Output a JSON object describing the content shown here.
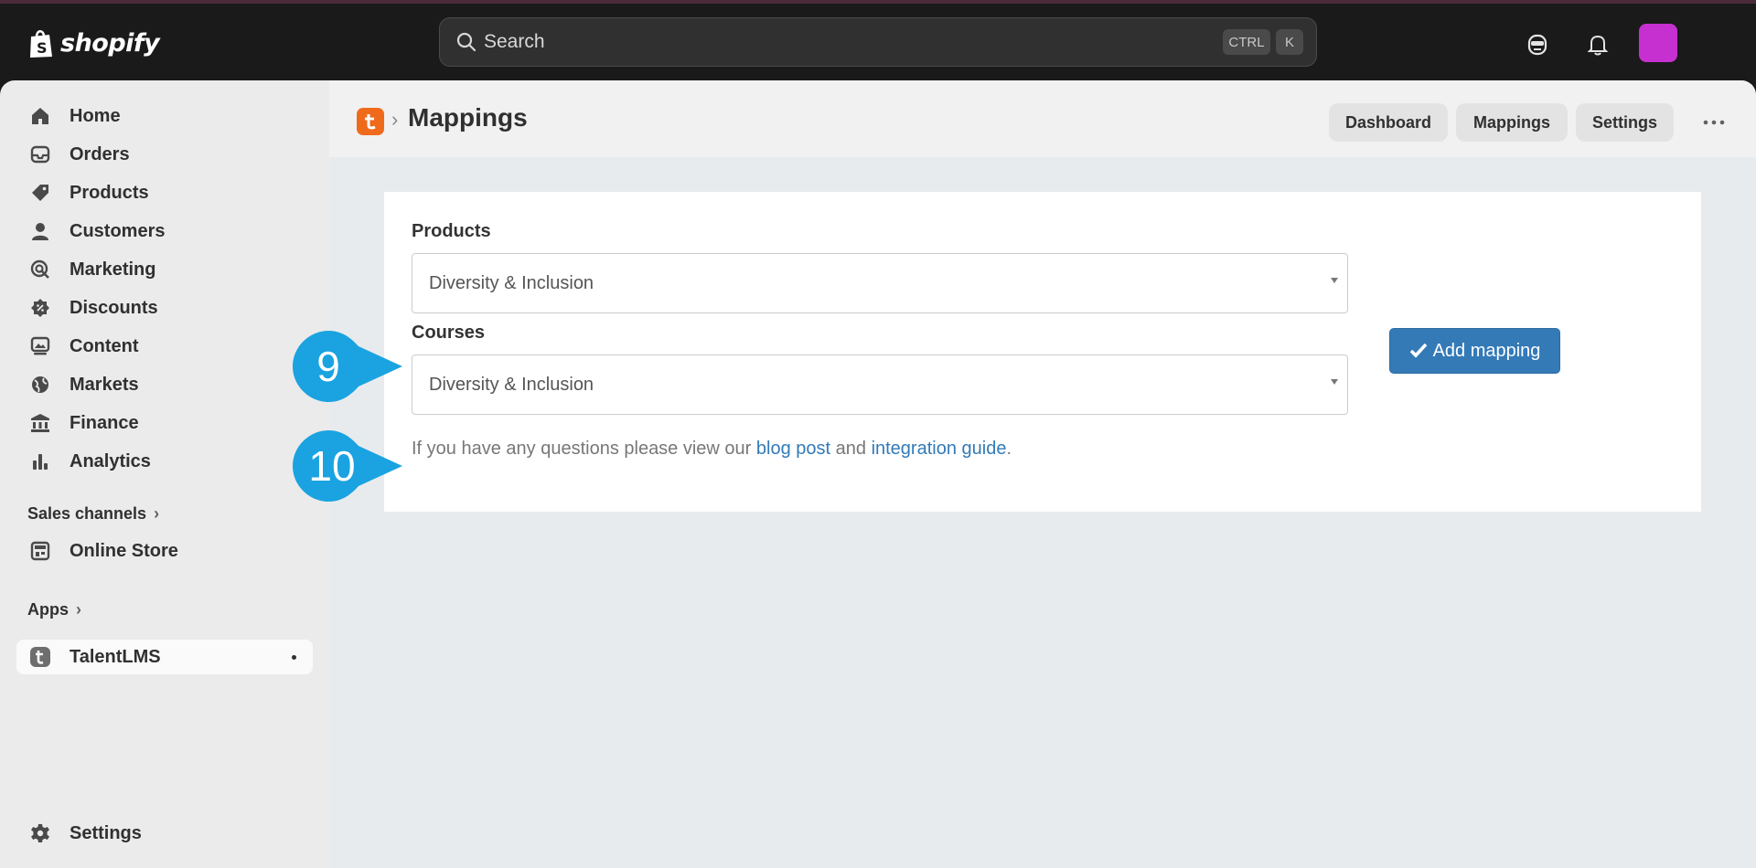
{
  "topbar": {
    "brand": "shopify",
    "search_placeholder": "Search",
    "shortcut_ctrl": "CTRL",
    "shortcut_k": "K",
    "icons": [
      "ghost-icon",
      "bell-icon"
    ],
    "avatar_color": "#c630d0"
  },
  "sidebar": {
    "items": [
      {
        "label": "Home",
        "icon": "home-icon"
      },
      {
        "label": "Orders",
        "icon": "inbox-icon"
      },
      {
        "label": "Products",
        "icon": "tag-icon"
      },
      {
        "label": "Customers",
        "icon": "person-icon"
      },
      {
        "label": "Marketing",
        "icon": "target-icon"
      },
      {
        "label": "Discounts",
        "icon": "discount-icon"
      },
      {
        "label": "Content",
        "icon": "image-icon"
      },
      {
        "label": "Markets",
        "icon": "globe-icon"
      },
      {
        "label": "Finance",
        "icon": "bank-icon"
      },
      {
        "label": "Analytics",
        "icon": "bar-chart-icon"
      }
    ],
    "sales_channels_label": "Sales channels",
    "online_store_label": "Online Store",
    "apps_label": "Apps",
    "talentlms_label": "TalentLMS",
    "settings_label": "Settings"
  },
  "header": {
    "app_logo_letter": "t",
    "title": "Mappings",
    "buttons": [
      "Dashboard",
      "Mappings",
      "Settings"
    ]
  },
  "form": {
    "products_label": "Products",
    "products_value": "Diversity & Inclusion",
    "courses_label": "Courses",
    "courses_value": "Diversity & Inclusion",
    "add_button": "Add mapping",
    "help_prefix": "If you have any questions please view our ",
    "help_link1": "blog post",
    "help_middle": " and ",
    "help_link2": "integration guide",
    "help_suffix": "."
  },
  "callouts": [
    "9",
    "10"
  ],
  "colors": {
    "accent": "#337ab7",
    "callout": "#1aa3e0",
    "app_logo": "#f06a1c"
  }
}
